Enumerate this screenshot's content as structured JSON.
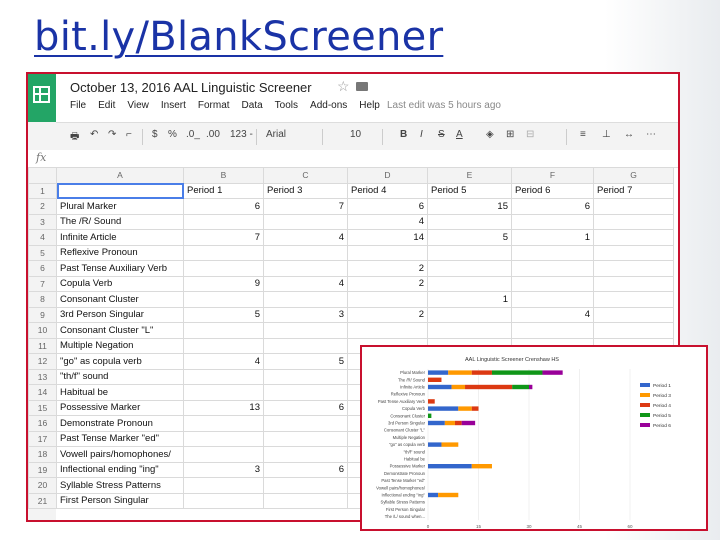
{
  "slide_title": "bit.ly/BlankScreener",
  "app": {
    "doc_title": "October 13, 2016 AAL Linguistic Screener",
    "menu": [
      "File",
      "Edit",
      "View",
      "Insert",
      "Format",
      "Data",
      "Tools",
      "Add-ons",
      "Help"
    ],
    "last_edit": "Last edit was 5 hours ago",
    "toolbar": {
      "zoom_pct": "%",
      ".0": ".0_",
      ".00": ".00",
      "num_fmt": "123 -",
      "font": "Arial",
      "size": "10",
      "bold": "B",
      "italic": "I",
      "strike": "S",
      "text_color": "A"
    },
    "fx": "fx"
  },
  "sheet": {
    "columns": [
      "",
      "A",
      "B",
      "C",
      "D",
      "E",
      "F",
      "G"
    ],
    "rows": [
      [
        "1",
        "",
        "Period 1",
        "Period 3",
        "Period 4",
        "Period 5",
        "Period 6",
        "Period 7"
      ],
      [
        "2",
        "Plural Marker",
        "6",
        "7",
        "6",
        "15",
        "6",
        ""
      ],
      [
        "3",
        "The /R/ Sound",
        "",
        "",
        "4",
        "",
        "",
        ""
      ],
      [
        "4",
        "Infinite Article",
        "7",
        "4",
        "14",
        "5",
        "1",
        ""
      ],
      [
        "5",
        "Reflexive Pronoun",
        "",
        "",
        "",
        "",
        "",
        ""
      ],
      [
        "6",
        "Past Tense Auxiliary Verb",
        "",
        "",
        "2",
        "",
        "",
        ""
      ],
      [
        "7",
        "Copula Verb",
        "9",
        "4",
        "2",
        "",
        "",
        ""
      ],
      [
        "8",
        "Consonant Cluster",
        "",
        "",
        "",
        "1",
        "",
        ""
      ],
      [
        "9",
        "3rd Person Singular",
        "5",
        "3",
        "2",
        "",
        "4",
        ""
      ],
      [
        "10",
        "Consonant Cluster \"L\"",
        "",
        "",
        "",
        "",
        "",
        ""
      ],
      [
        "11",
        "Multiple Negation",
        "",
        "",
        "",
        "",
        "",
        ""
      ],
      [
        "12",
        "\"go\" as copula verb",
        "4",
        "5",
        "",
        "",
        "",
        ""
      ],
      [
        "13",
        "\"th/f\" sound",
        "",
        "",
        "",
        "",
        "",
        ""
      ],
      [
        "14",
        "Habitual be",
        "",
        "",
        "",
        "",
        "",
        ""
      ],
      [
        "15",
        "Possessive Marker",
        "13",
        "6",
        "",
        "",
        "",
        ""
      ],
      [
        "16",
        "Demonstrate Pronoun",
        "",
        "",
        "",
        "",
        "",
        ""
      ],
      [
        "17",
        "Past Tense Marker \"ed\"",
        "",
        "",
        "",
        "",
        "",
        ""
      ],
      [
        "18",
        "Vowell pairs/homophones/",
        "",
        "",
        "",
        "",
        "",
        ""
      ],
      [
        "19",
        "Inflectional ending \"ing\"",
        "3",
        "6",
        "",
        "",
        "",
        ""
      ],
      [
        "20",
        "Syllable Stress Patterns",
        "",
        "",
        "",
        "",
        "",
        ""
      ],
      [
        "21",
        "First Person Singular",
        "",
        "",
        "",
        "",
        "",
        ""
      ]
    ]
  },
  "chart_data": {
    "type": "bar",
    "orientation": "horizontal",
    "stacked": true,
    "title": "AAL Linguistic Screener Crenshaw HS",
    "categories": [
      "Plural Marker",
      "The /R/ Sound",
      "Infinite Article",
      "Reflexive Pronoun",
      "Past Tense Auxiliary Verb",
      "Copula Verb",
      "Consonant Cluster",
      "3rd Person Singular",
      "Consonant Cluster \"L\"",
      "Multiple Negation",
      "\"go\" as copula verb",
      "\"th/f\" sound",
      "Habitual be",
      "Possessive Marker",
      "Demonstrate Pronoun",
      "Past Tense Marker \"ed\"",
      "Vowell pairs/homophones/",
      "Inflectional ending \"ing\"",
      "Syllable Stress Patterns",
      "First Person Singular",
      "The /L/ sound when..."
    ],
    "series": [
      {
        "name": "Period 1",
        "color": "#3366cc",
        "values": [
          6,
          0,
          7,
          0,
          0,
          9,
          0,
          5,
          0,
          0,
          4,
          0,
          0,
          13,
          0,
          0,
          0,
          3,
          0,
          0,
          0
        ]
      },
      {
        "name": "Period 3",
        "color": "#ff9900",
        "values": [
          7,
          0,
          4,
          0,
          0,
          4,
          0,
          3,
          0,
          0,
          5,
          0,
          0,
          6,
          0,
          0,
          0,
          6,
          0,
          0,
          0
        ]
      },
      {
        "name": "Period 4",
        "color": "#dc3912",
        "values": [
          6,
          4,
          14,
          0,
          2,
          2,
          0,
          2,
          0,
          0,
          0,
          0,
          0,
          0,
          0,
          0,
          0,
          0,
          0,
          0,
          0
        ]
      },
      {
        "name": "Period 5",
        "color": "#109618",
        "values": [
          15,
          0,
          5,
          0,
          0,
          0,
          1,
          0,
          0,
          0,
          0,
          0,
          0,
          0,
          0,
          0,
          0,
          0,
          0,
          0,
          0
        ]
      },
      {
        "name": "Period 6",
        "color": "#990099",
        "values": [
          6,
          0,
          1,
          0,
          0,
          0,
          0,
          4,
          0,
          0,
          0,
          0,
          0,
          0,
          0,
          0,
          0,
          0,
          0,
          0,
          0
        ]
      }
    ],
    "xticks": [
      "0",
      "15",
      "30",
      "45",
      "60"
    ],
    "xlim": [
      0,
      60
    ],
    "legend_position": "right"
  }
}
